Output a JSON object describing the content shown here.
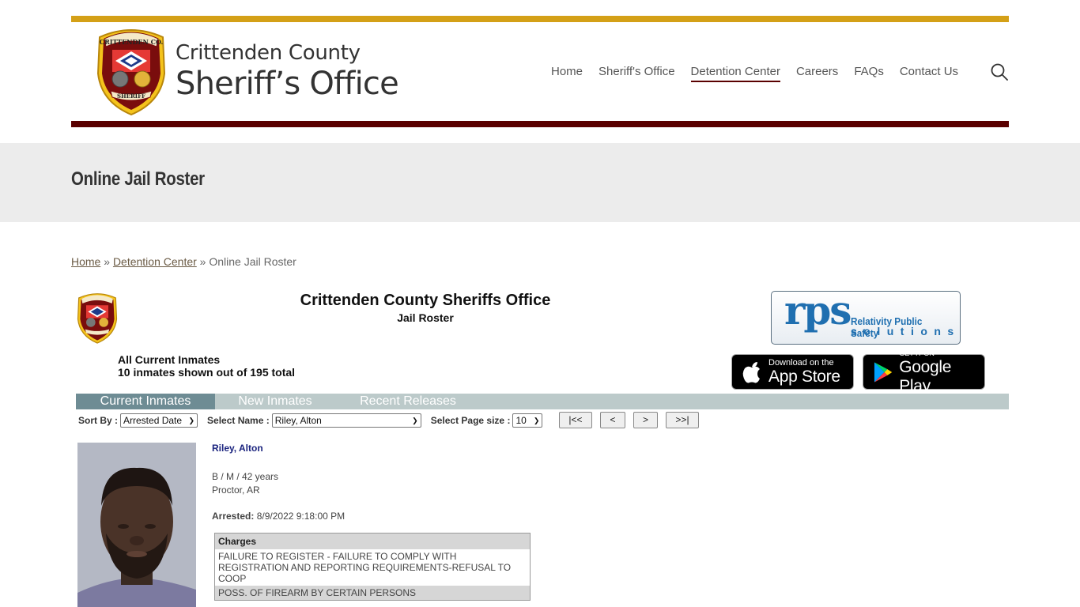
{
  "header": {
    "logo_line1": "Crittenden County",
    "logo_line2": "Sheriff’s Office",
    "nav": [
      {
        "label": "Home",
        "active": false
      },
      {
        "label": "Sheriff's Office",
        "active": false
      },
      {
        "label": "Detention Center",
        "active": true
      },
      {
        "label": "Careers",
        "active": false
      },
      {
        "label": "FAQs",
        "active": false
      },
      {
        "label": "Contact Us",
        "active": false
      }
    ],
    "search_icon": "search-icon"
  },
  "colors": {
    "gold": "#d4a017",
    "maroon": "#5a0000",
    "tab_active": "#6e8c94",
    "tab_bar": "#bccaca",
    "name_link": "#1a237e"
  },
  "page": {
    "title": "Online Jail Roster",
    "breadcrumb": {
      "home": "Home",
      "sep1": " » ",
      "detention": "Detention Center",
      "sep2": " » ",
      "current": "Online Jail Roster"
    }
  },
  "roster": {
    "org_title": "Crittenden County Sheriffs Office",
    "subtitle": "Jail Roster",
    "list_label": "All Current Inmates",
    "count_text": "10 inmates shown out of 195 total",
    "vendor": {
      "abbr": "rps",
      "name": "Relativity Public Safety",
      "tagline": "solutions"
    },
    "app_store": {
      "line1": "Download on the",
      "line2": "App Store"
    },
    "google_play": {
      "line1": "GET IT ON",
      "line2": "Google Play"
    },
    "tabs": [
      {
        "label": "Current Inmates",
        "active": true
      },
      {
        "label": "New Inmates",
        "active": false
      },
      {
        "label": "Recent Releases",
        "active": false
      }
    ],
    "controls": {
      "sort_label": "Sort By :",
      "sort_value": "Arrested Date",
      "name_label": "Select Name :",
      "name_value": "Riley, Alton",
      "page_size_label": "Select Page size :",
      "page_size_value": "10",
      "first": "|<<",
      "prev": "<",
      "next": ">",
      "last": ">>|"
    },
    "inmate": {
      "name": "Riley, Alton",
      "demographics": "B / M / 42 years",
      "location": "Proctor, AR",
      "arrested_label": "Arrested:",
      "arrested_value": "8/9/2022 9:18:00 PM",
      "charges_header": "Charges",
      "charges": [
        "FAILURE TO REGISTER - FAILURE TO COMPLY WITH REGISTRATION AND REPORTING REQUIREMENTS-REFUSAL TO COOP",
        "POSS. OF FIREARM BY CERTAIN PERSONS"
      ]
    }
  }
}
